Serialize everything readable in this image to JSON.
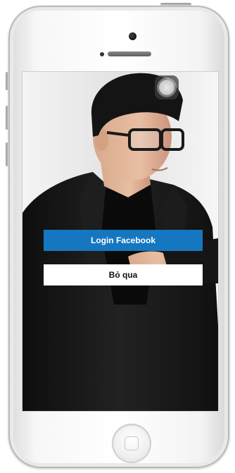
{
  "login": {
    "facebook_label": "Login Facebook",
    "skip_label": "Bỏ qua"
  },
  "colors": {
    "facebook_blue": "#1577c0",
    "skip_background": "#ffffff",
    "suit": "#161616",
    "background": "#e8e8e8"
  },
  "icons": {
    "assistive_touch": "assistive-touch-icon",
    "home_button": "home-button-icon"
  }
}
